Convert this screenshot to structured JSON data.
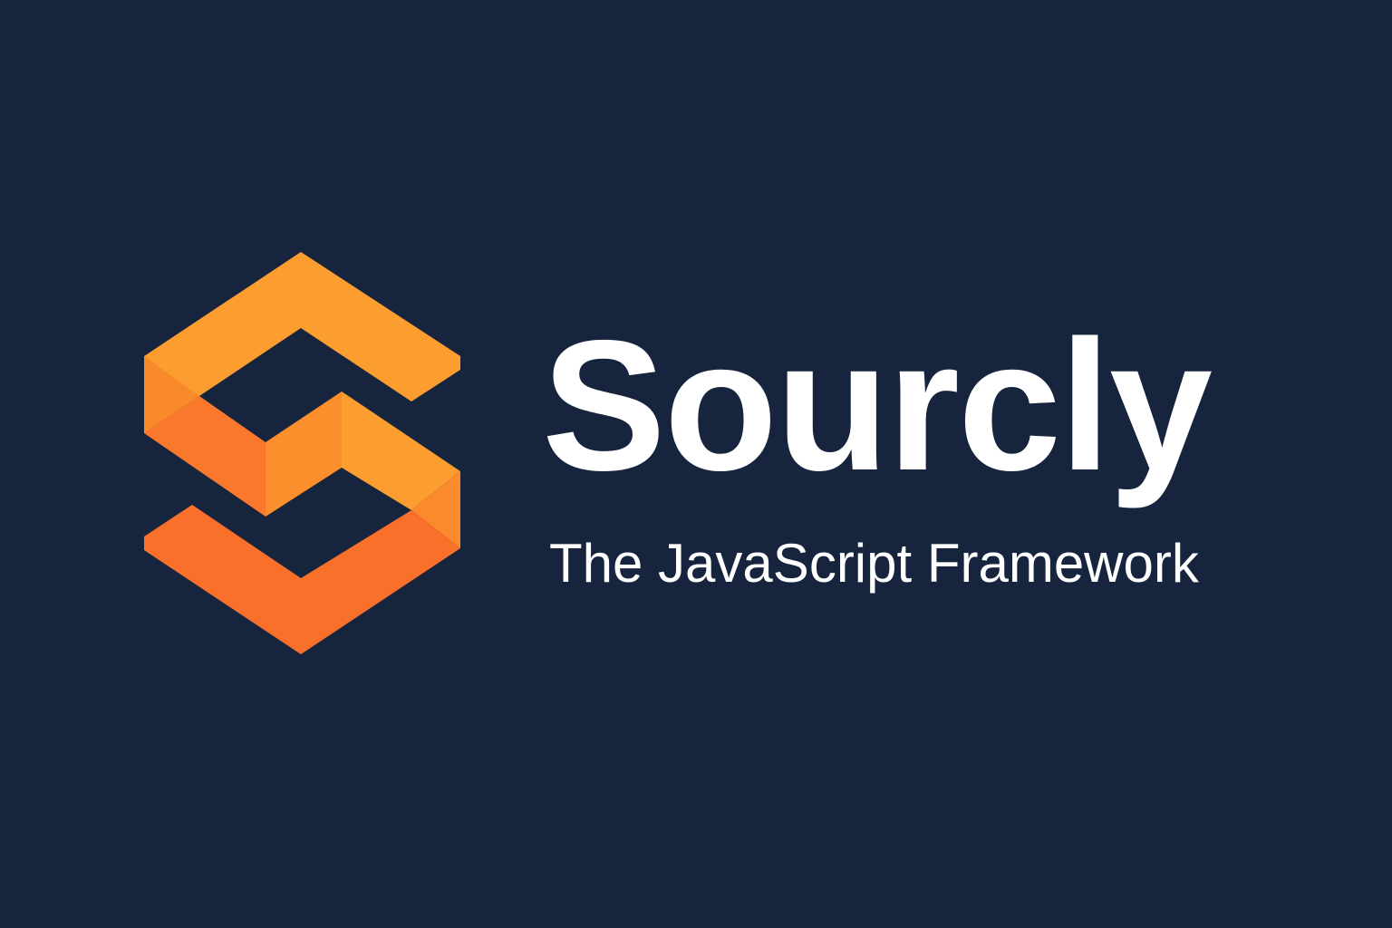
{
  "brand": {
    "name": "Sourcly",
    "tagline": "The JavaScript Framework"
  },
  "icons": {
    "logo": "sourcly-s-logo-icon"
  },
  "colors": {
    "background": "#16243d",
    "logo_light_orange": "#fb9d2f",
    "logo_mid_orange": "#f98a2a",
    "logo_dark_orange": "#f9702b",
    "text": "#ffffff"
  }
}
